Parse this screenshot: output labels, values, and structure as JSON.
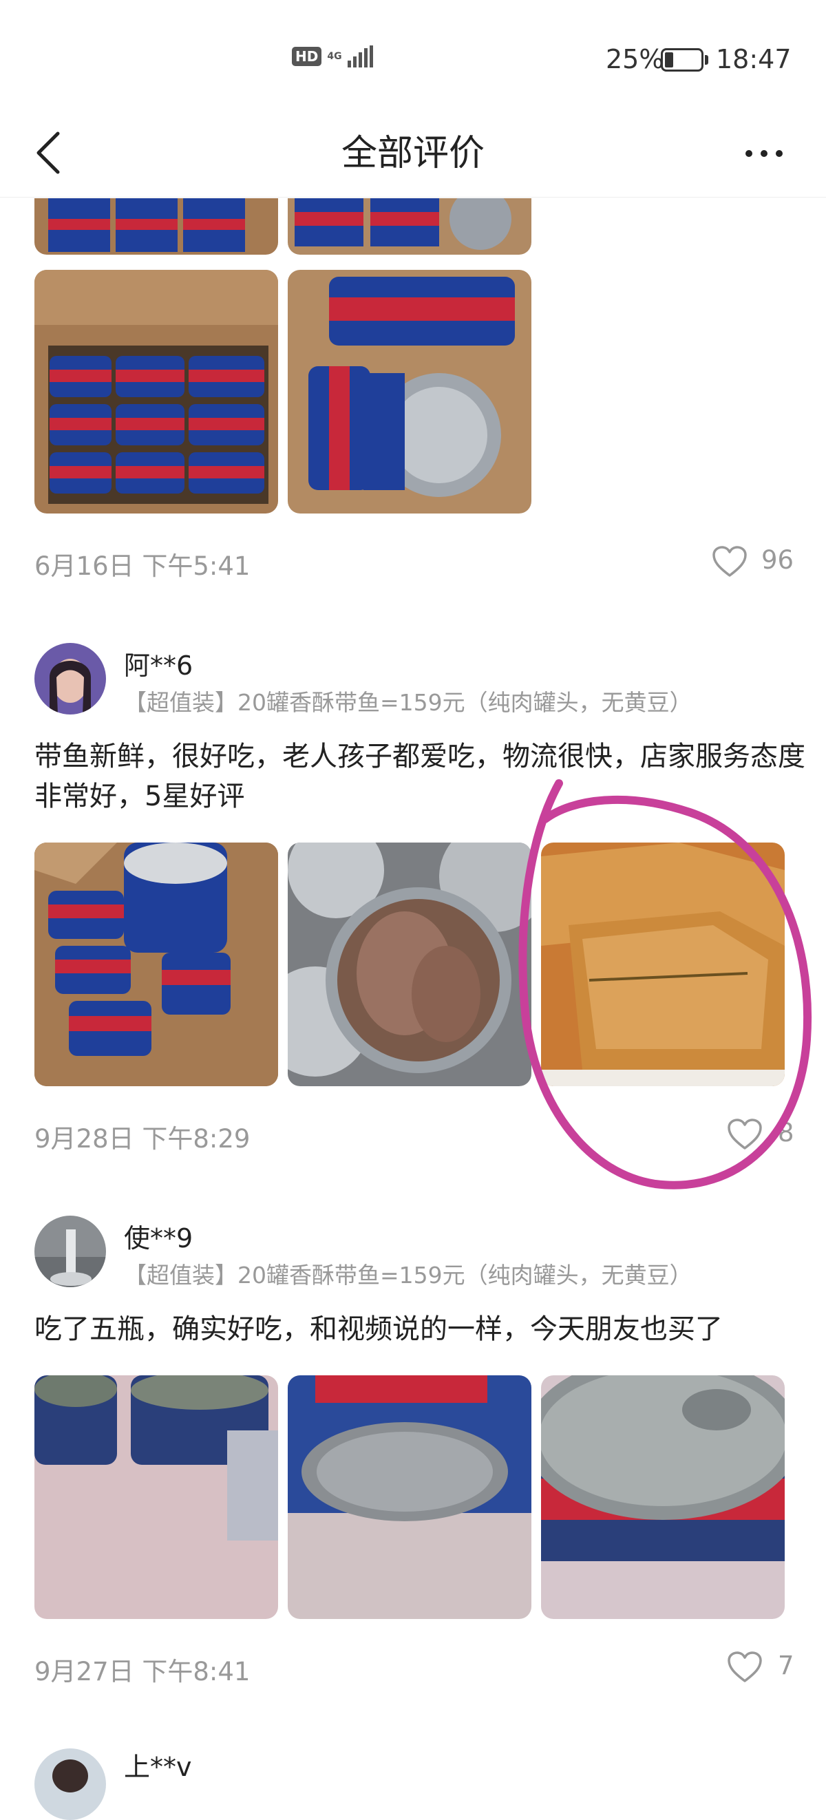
{
  "status_bar": {
    "hd": "HD",
    "network": "4G",
    "battery": "25%",
    "time": "18:47"
  },
  "nav": {
    "title": "全部评价"
  },
  "reviews": [
    {
      "date": "6月16日 下午5:41",
      "likes": "96"
    },
    {
      "username": "阿**6",
      "variant": "【超值装】20罐香酥带鱼=159元（纯肉罐头，无黄豆）",
      "text": "带鱼新鲜，很好吃，老人孩子都爱吃，物流很快，店家服务态度非常好，5星好评",
      "date": "9月28日 下午8:29",
      "likes": "8"
    },
    {
      "username": "使**9",
      "variant": "【超值装】20罐香酥带鱼=159元（纯肉罐头，无黄豆）",
      "text": "吃了五瓶，确实好吃，和视频说的一样，今天朋友也买了",
      "date": "9月27日 下午8:41",
      "likes": "7"
    },
    {
      "username": "上**v"
    }
  ],
  "colors": {
    "accent_annotation": "#c8409a",
    "can_blue": "#1f3f9a",
    "can_red": "#c8283a",
    "box": "#a57a52"
  }
}
